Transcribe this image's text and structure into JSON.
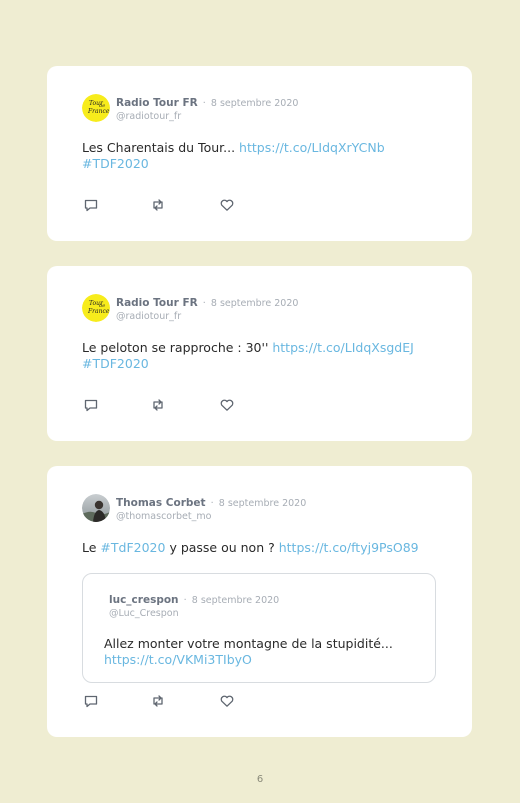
{
  "tweets": [
    {
      "name": "Radio Tour FR",
      "date": "8 septembre 2020",
      "handle": "@radiotour_fr",
      "avatar_icon": "tour-de-france-logo",
      "text_before": "Les Charentais du Tour... ",
      "link": "https://t.co/LIdqXrYCNb",
      "text_after": "",
      "hashtag_line": "#TDF2020"
    },
    {
      "name": "Radio Tour FR",
      "date": "8 septembre 2020",
      "handle": "@radiotour_fr",
      "avatar_icon": "tour-de-france-logo",
      "text_before": "Le peloton se rapproche : 30'' ",
      "link": "https://t.co/LIdqXsgdEJ",
      "text_after": "",
      "hashtag_line": "#TDF2020"
    },
    {
      "name": "Thomas Corbet",
      "date": "8 septembre 2020",
      "handle": "@thomascorbet_mo",
      "avatar_icon": "user-photo",
      "text_before": "Le ",
      "hashtag": "#TdF2020",
      "text_middle": " y passe ou non ? ",
      "link": "https://t.co/ftyj9PsO89",
      "quote": {
        "name": "luc_crespon",
        "date": "8 septembre 2020",
        "handle": "@Luc_Crespon",
        "text": "Allez monter votre montagne de la stupidité...",
        "link": "https://t.co/VKMi3TIbyO"
      }
    }
  ],
  "separator": "·",
  "logo_text": [
    "Tour",
    "de",
    "France"
  ],
  "page_number": "6",
  "colors": {
    "background": "#efedd2",
    "link": "#69b7e0",
    "logo_yellow": "#f7ec1c"
  },
  "icons": [
    "reply-icon",
    "retweet-icon",
    "like-icon"
  ]
}
